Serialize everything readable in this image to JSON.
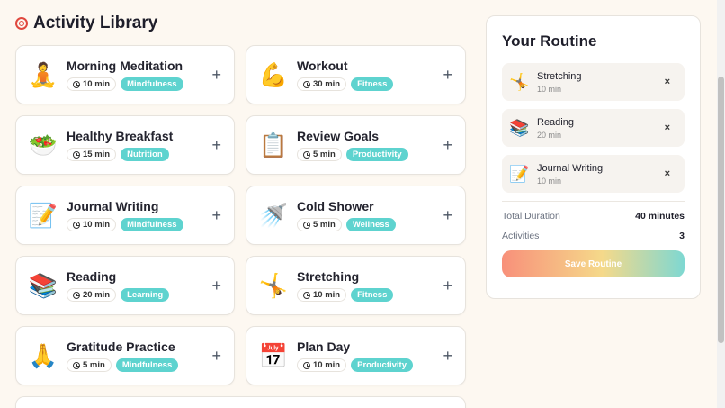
{
  "header": {
    "title": "Activity Library",
    "icon": "target-icon"
  },
  "activities": [
    {
      "title": "Morning Meditation",
      "duration": "10 min",
      "tag": "Mindfulness",
      "icon": "🧘"
    },
    {
      "title": "Workout",
      "duration": "30 min",
      "tag": "Fitness",
      "icon": "💪"
    },
    {
      "title": "Healthy Breakfast",
      "duration": "15 min",
      "tag": "Nutrition",
      "icon": "🥗"
    },
    {
      "title": "Review Goals",
      "duration": "5 min",
      "tag": "Productivity",
      "icon": "📋"
    },
    {
      "title": "Journal Writing",
      "duration": "10 min",
      "tag": "Mindfulness",
      "icon": "📝"
    },
    {
      "title": "Cold Shower",
      "duration": "5 min",
      "tag": "Wellness",
      "icon": "🚿"
    },
    {
      "title": "Reading",
      "duration": "20 min",
      "tag": "Learning",
      "icon": "📚"
    },
    {
      "title": "Stretching",
      "duration": "10 min",
      "tag": "Fitness",
      "icon": "🤸"
    },
    {
      "title": "Gratitude Practice",
      "duration": "5 min",
      "tag": "Mindfulness",
      "icon": "🙏"
    },
    {
      "title": "Plan Day",
      "duration": "10 min",
      "tag": "Productivity",
      "icon": "📅"
    }
  ],
  "routine": {
    "title": "Your Routine",
    "items": [
      {
        "title": "Stretching",
        "duration": "10 min",
        "icon": "🤸"
      },
      {
        "title": "Reading",
        "duration": "20 min",
        "icon": "📚"
      },
      {
        "title": "Journal Writing",
        "duration": "10 min",
        "icon": "📝"
      }
    ],
    "remove_label": "×",
    "total_label": "Total Duration",
    "total_value": "40 minutes",
    "count_label": "Activities",
    "count_value": "3",
    "save_label": "Save Routine"
  },
  "colors": {
    "tag": "#5ed3cf",
    "background": "#fdf8f1"
  }
}
